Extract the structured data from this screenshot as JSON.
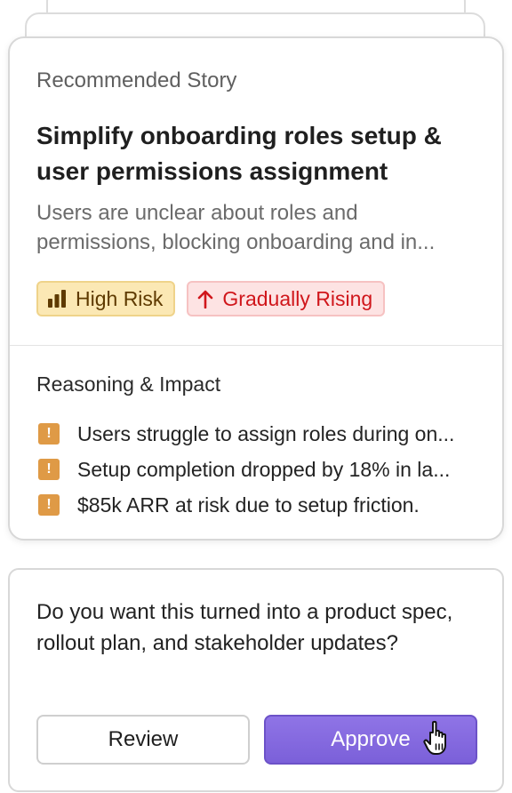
{
  "story": {
    "eyebrow": "Recommended Story",
    "title": "Simplify onboarding roles setup & user permissions assignment",
    "description_lines": [
      "Users are unclear about roles and",
      "permissions, blocking onboarding and in..."
    ],
    "badges": {
      "risk": {
        "label": "High Risk",
        "icon": "bar-chart-icon",
        "color": "#5e3a00",
        "bg": "#fbe8b4"
      },
      "trend": {
        "label": "Gradually Rising",
        "icon": "arrow-up-icon",
        "color": "#d0161b",
        "bg": "#fde3e3"
      }
    },
    "reasoning": {
      "title": "Reasoning & Impact",
      "items": [
        {
          "icon": "warning-icon",
          "text": "Users struggle to assign roles during on..."
        },
        {
          "icon": "warning-icon",
          "text": "Setup completion dropped by 18% in la..."
        },
        {
          "icon": "warning-icon",
          "text": "$85k ARR at risk due to setup friction."
        }
      ]
    }
  },
  "prompt": {
    "question": "Do you want this turned into a product spec, rollout plan, and stakeholder updates?",
    "review_label": "Review",
    "approve_label": "Approve",
    "accent": "#7b60d9"
  }
}
